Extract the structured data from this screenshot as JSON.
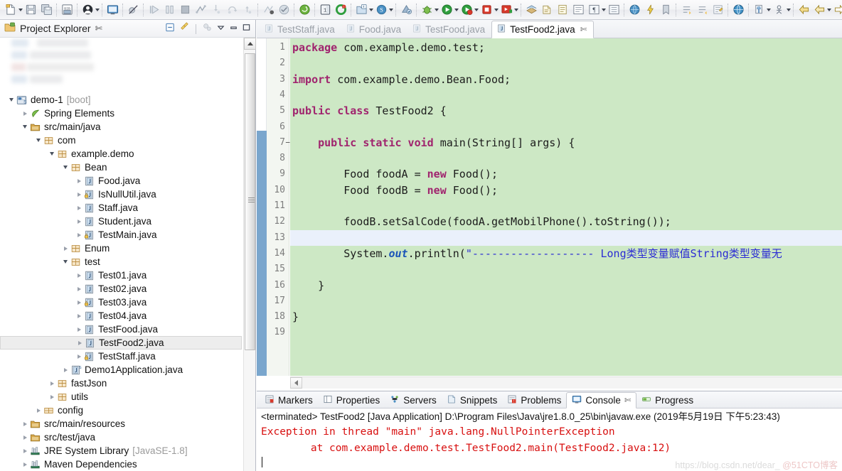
{
  "toolbar": {
    "groups": [
      {
        "items": [
          {
            "name": "new-wizard-icon",
            "type": "new",
            "arrow": true
          },
          {
            "name": "save-icon",
            "type": "save"
          },
          {
            "name": "save-all-icon",
            "type": "saveall"
          }
        ]
      },
      {
        "items": [
          {
            "name": "new-java-package-icon",
            "type": "pkg"
          }
        ]
      },
      {
        "items": [
          {
            "name": "user-profile-icon",
            "type": "user",
            "arrow": true
          }
        ]
      },
      {
        "items": [
          {
            "name": "open-console-icon",
            "type": "console"
          }
        ]
      },
      {
        "items": [
          {
            "name": "skip-breakpoints-icon",
            "type": "skipbp"
          }
        ]
      },
      {
        "items": [
          {
            "name": "resume-icon",
            "type": "resume"
          },
          {
            "name": "suspend-icon",
            "type": "suspend"
          },
          {
            "name": "terminate-icon",
            "type": "terminate"
          },
          {
            "name": "disconnect-icon",
            "type": "disconnect"
          },
          {
            "name": "step-into-icon",
            "type": "stepinto"
          },
          {
            "name": "step-over-icon",
            "type": "stepover"
          },
          {
            "name": "step-return-icon",
            "type": "stepreturn"
          }
        ]
      },
      {
        "items": [
          {
            "name": "coverage-icon",
            "type": "cov1"
          },
          {
            "name": "coverage-session-icon",
            "type": "cov2"
          }
        ]
      },
      {
        "items": [
          {
            "name": "spring-boot-dashboard-icon",
            "type": "boot"
          }
        ]
      },
      {
        "items": [
          {
            "name": "toggle-breakpoint-icon",
            "type": "togglebp"
          },
          {
            "name": "restart-icon",
            "type": "restart"
          }
        ]
      },
      {
        "items": [
          {
            "name": "new-java-project-icon",
            "type": "javaproj",
            "arrow": true
          },
          {
            "name": "new-spring-project-icon",
            "type": "springproj",
            "arrow": true
          }
        ]
      },
      {
        "items": [
          {
            "name": "refresh-maven-icon",
            "type": "mvnref"
          }
        ]
      },
      {
        "items": [
          {
            "name": "debug-icon",
            "type": "debug",
            "arrow": true
          },
          {
            "name": "run-icon",
            "type": "run",
            "arrow": true
          },
          {
            "name": "coverage-run-icon",
            "type": "covrun",
            "arrow": true
          },
          {
            "name": "stop-icon",
            "type": "stop",
            "arrow": true
          },
          {
            "name": "run-external-tools-icon",
            "type": "exttools",
            "arrow": true
          }
        ]
      },
      {
        "items": [
          {
            "name": "open-perspective-icon",
            "type": "persp"
          },
          {
            "name": "open-type-icon",
            "type": "opentype"
          },
          {
            "name": "open-task-icon",
            "type": "opentask"
          },
          {
            "name": "new-class-icon",
            "type": "newclass"
          },
          {
            "name": "new-annotation-icon",
            "type": "newann",
            "arrow": true
          },
          {
            "name": "new-package-icon",
            "type": "newpkg"
          }
        ]
      },
      {
        "items": [
          {
            "name": "search-icon",
            "type": "search"
          },
          {
            "name": "lightning-icon",
            "type": "lightning"
          },
          {
            "name": "bookmark-icon",
            "type": "bookmark"
          }
        ]
      },
      {
        "items": [
          {
            "name": "next-annotation-icon",
            "type": "nextann"
          },
          {
            "name": "previous-annotation-icon",
            "type": "prevann"
          },
          {
            "name": "last-edit-location-icon",
            "type": "lastedit"
          }
        ]
      },
      {
        "items": [
          {
            "name": "web-browser-icon",
            "type": "web"
          }
        ]
      },
      {
        "items": [
          {
            "name": "pin-editor-icon",
            "type": "pin",
            "arrow": true
          },
          {
            "name": "person-icon",
            "type": "person2",
            "arrow": true
          }
        ]
      },
      {
        "items": [
          {
            "name": "back-history-icon",
            "type": "back1"
          },
          {
            "name": "back-navigate-icon",
            "type": "back2",
            "arrow": true
          },
          {
            "name": "forward-navigate-icon",
            "type": "forward",
            "arrow": true
          }
        ]
      }
    ]
  },
  "project_explorer": {
    "title": "Project Explorer",
    "close_glyph": "✄",
    "tools": [
      {
        "name": "collapse-all-icon"
      },
      {
        "name": "link-with-editor-icon"
      },
      {
        "name": "view-menu-filter-icon"
      },
      {
        "name": "view-menu-icon"
      },
      {
        "name": "minimize-view-icon"
      },
      {
        "name": "maximize-view-icon"
      }
    ],
    "tree": [
      {
        "label": "demo-1",
        "suffix": "[boot]",
        "indent": 0,
        "twist": "open",
        "icon": "spring-project",
        "selected": false
      },
      {
        "label": "Spring Elements",
        "indent": 1,
        "twist": "closed",
        "icon": "spring-leaf"
      },
      {
        "label": "src/main/java",
        "indent": 1,
        "twist": "open",
        "icon": "source-folder"
      },
      {
        "label": "com",
        "indent": 2,
        "twist": "open",
        "icon": "package"
      },
      {
        "label": "example.demo",
        "indent": 3,
        "twist": "open",
        "icon": "package"
      },
      {
        "label": "Bean",
        "indent": 4,
        "twist": "open",
        "icon": "package"
      },
      {
        "label": "Food.java",
        "indent": 5,
        "twist": "closed",
        "icon": "java-file"
      },
      {
        "label": "IsNullUtil.java",
        "indent": 5,
        "twist": "closed",
        "icon": "java-file-lock"
      },
      {
        "label": "Staff.java",
        "indent": 5,
        "twist": "closed",
        "icon": "java-file"
      },
      {
        "label": "Student.java",
        "indent": 5,
        "twist": "closed",
        "icon": "java-file"
      },
      {
        "label": "TestMain.java",
        "indent": 5,
        "twist": "closed",
        "icon": "java-file-lock"
      },
      {
        "label": "Enum",
        "indent": 4,
        "twist": "closed",
        "icon": "package"
      },
      {
        "label": "test",
        "indent": 4,
        "twist": "open",
        "icon": "package"
      },
      {
        "label": "Test01.java",
        "indent": 5,
        "twist": "closed",
        "icon": "java-file"
      },
      {
        "label": "Test02.java",
        "indent": 5,
        "twist": "closed",
        "icon": "java-file"
      },
      {
        "label": "Test03.java",
        "indent": 5,
        "twist": "closed",
        "icon": "java-file-lock"
      },
      {
        "label": "Test04.java",
        "indent": 5,
        "twist": "closed",
        "icon": "java-file"
      },
      {
        "label": "TestFood.java",
        "indent": 5,
        "twist": "closed",
        "icon": "java-file"
      },
      {
        "label": "TestFood2.java",
        "indent": 5,
        "twist": "closed",
        "icon": "java-file",
        "selected": true
      },
      {
        "label": "TestStaff.java",
        "indent": 5,
        "twist": "closed",
        "icon": "java-file-lock"
      },
      {
        "label": "Demo1Application.java",
        "indent": 4,
        "twist": "closed",
        "icon": "java-main-file"
      },
      {
        "label": "fastJson",
        "indent": 3,
        "twist": "closed",
        "icon": "package"
      },
      {
        "label": "utils",
        "indent": 3,
        "twist": "closed",
        "icon": "package"
      },
      {
        "label": "config",
        "indent": 2,
        "twist": "closed",
        "icon": "package-flat"
      },
      {
        "label": "src/main/resources",
        "indent": 1,
        "twist": "closed",
        "icon": "source-folder"
      },
      {
        "label": "src/test/java",
        "indent": 1,
        "twist": "closed",
        "icon": "source-folder"
      },
      {
        "label": "JRE System Library",
        "suffix": "[JavaSE-1.8]",
        "indent": 1,
        "twist": "closed",
        "icon": "library"
      },
      {
        "label": "Maven Dependencies",
        "indent": 1,
        "twist": "closed",
        "icon": "library"
      }
    ]
  },
  "editor": {
    "tabs": [
      {
        "label": "TestStaff.java",
        "active": false
      },
      {
        "label": "Food.java",
        "active": false
      },
      {
        "label": "TestFood.java",
        "active": false
      },
      {
        "label": "TestFood2.java",
        "active": true,
        "close_glyph": "✄"
      }
    ],
    "lines": [
      {
        "num": "1",
        "fold": "",
        "current": false,
        "tokens": [
          {
            "t": "package",
            "c": "k"
          },
          {
            "t": " com.example.demo.test;",
            "c": ""
          }
        ]
      },
      {
        "num": "2",
        "fold": "",
        "current": false,
        "tokens": []
      },
      {
        "num": "3",
        "fold": "",
        "current": false,
        "tokens": [
          {
            "t": "import",
            "c": "k"
          },
          {
            "t": " com.example.demo.Bean.Food;",
            "c": ""
          }
        ]
      },
      {
        "num": "4",
        "fold": "",
        "current": false,
        "tokens": []
      },
      {
        "num": "5",
        "fold": "",
        "current": false,
        "tokens": [
          {
            "t": "public class",
            "c": "k"
          },
          {
            "t": " TestFood2 {",
            "c": ""
          }
        ]
      },
      {
        "num": "6",
        "fold": "",
        "current": false,
        "tokens": []
      },
      {
        "num": "7",
        "fold": "⊖",
        "current": false,
        "tokens": [
          {
            "t": "    ",
            "c": ""
          },
          {
            "t": "public static void",
            "c": "k"
          },
          {
            "t": " main(String[] args) {",
            "c": ""
          }
        ]
      },
      {
        "num": "8",
        "fold": "",
        "current": false,
        "tokens": []
      },
      {
        "num": "9",
        "fold": "",
        "current": false,
        "tokens": [
          {
            "t": "        Food foodA = ",
            "c": ""
          },
          {
            "t": "new",
            "c": "k"
          },
          {
            "t": " Food();",
            "c": ""
          }
        ]
      },
      {
        "num": "10",
        "fold": "",
        "current": false,
        "tokens": [
          {
            "t": "        Food foodB = ",
            "c": ""
          },
          {
            "t": "new",
            "c": "k"
          },
          {
            "t": " Food();",
            "c": ""
          }
        ]
      },
      {
        "num": "11",
        "fold": "",
        "current": false,
        "tokens": []
      },
      {
        "num": "12",
        "fold": "",
        "current": false,
        "tokens": [
          {
            "t": "        foodB.setSalCode(foodA.getMobilPhone().toString());",
            "c": ""
          }
        ]
      },
      {
        "num": "13",
        "fold": "",
        "current": true,
        "tokens": []
      },
      {
        "num": "14",
        "fold": "",
        "current": false,
        "tokens": [
          {
            "t": "        System.",
            "c": ""
          },
          {
            "t": "out",
            "c": "fld"
          },
          {
            "t": ".println(",
            "c": ""
          },
          {
            "t": "\"------------------- Long类型变量赋值String类型变量无",
            "c": "s"
          }
        ]
      },
      {
        "num": "15",
        "fold": "",
        "current": false,
        "tokens": []
      },
      {
        "num": "16",
        "fold": "",
        "current": false,
        "tokens": [
          {
            "t": "    }",
            "c": ""
          }
        ]
      },
      {
        "num": "17",
        "fold": "",
        "current": false,
        "tokens": []
      },
      {
        "num": "18",
        "fold": "",
        "current": false,
        "tokens": [
          {
            "t": "}",
            "c": ""
          }
        ]
      },
      {
        "num": "19",
        "fold": "",
        "current": false,
        "tokens": []
      }
    ]
  },
  "bottom_panel": {
    "tabs": [
      {
        "label": "Markers",
        "icon": "markers-icon",
        "active": false
      },
      {
        "label": "Properties",
        "icon": "properties-icon",
        "active": false
      },
      {
        "label": "Servers",
        "icon": "servers-icon",
        "active": false
      },
      {
        "label": "Snippets",
        "icon": "snippets-icon",
        "active": false
      },
      {
        "label": "Problems",
        "icon": "problems-icon",
        "active": false
      },
      {
        "label": "Console",
        "icon": "console-icon",
        "active": true,
        "close_glyph": "✄"
      },
      {
        "label": "Progress",
        "icon": "progress-icon",
        "active": false
      }
    ],
    "console": {
      "header": "<terminated> TestFood2 [Java Application] D:\\Program Files\\Java\\jre1.8.0_25\\bin\\javaw.exe (2019年5月19日 下午5:23:43)",
      "error_lines": [
        "Exception in thread \"main\" java.lang.NullPointerException",
        "        at com.example.demo.test.TestFood2.main(TestFood2.java:12)"
      ]
    }
  },
  "watermark": {
    "url": "https://blog.csdn.net/dear_",
    "tag": "@51CTO博客"
  }
}
